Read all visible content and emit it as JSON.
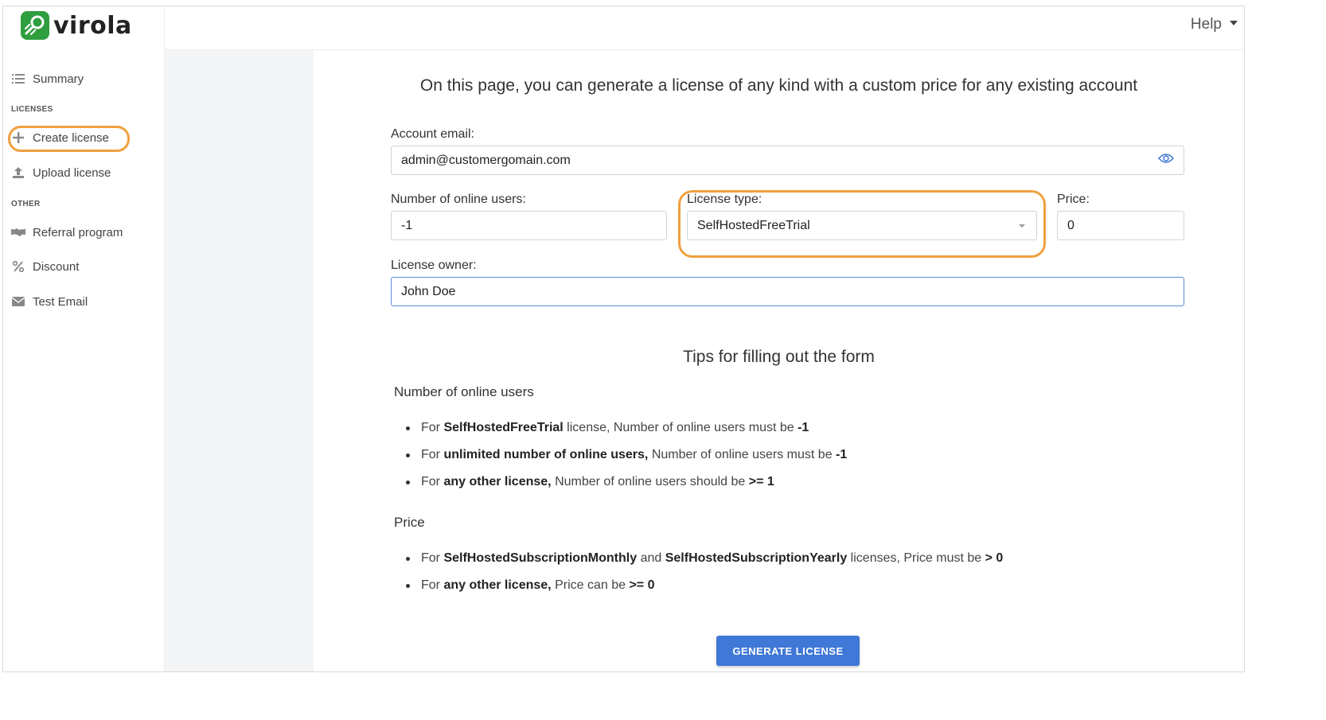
{
  "app": {
    "logo_text": "virola",
    "brand_color": "#2e9e3e",
    "highlight_color": "#f0a040",
    "accent_color": "#3f78d6"
  },
  "topbar": {
    "help_label": "Help"
  },
  "sidebar": {
    "summary_label": "Summary",
    "section_licenses": "LICENSES",
    "create_license_label": "Create license",
    "upload_license_label": "Upload license",
    "section_other": "OTHER",
    "referral_label": "Referral program",
    "discount_label": "Discount",
    "test_email_label": "Test Email"
  },
  "form": {
    "intro": "On this page, you can generate a license of any kind with a custom price for any existing account",
    "email_label": "Account email:",
    "email_value": "admin@customergomain.com",
    "users_label": "Number of online users:",
    "users_value": "-1",
    "license_type_label": "License type:",
    "license_type_value": "SelfHostedFreeTrial",
    "price_label": "Price:",
    "price_value": "0",
    "owner_label": "License owner:",
    "owner_value": "John Doe",
    "generate_button": "GENERATE LICENSE"
  },
  "tips": {
    "title": "Tips for filling out the form",
    "users_heading": "Number of online users",
    "users_tips": [
      {
        "pre": "For ",
        "bold": "SelfHostedFreeTrial",
        "mid": " license, Number of online users must be ",
        "bold2": "-1"
      },
      {
        "pre": "For ",
        "bold": "unlimited number of online users,",
        "mid": " Number of online users must be ",
        "bold2": "-1"
      },
      {
        "pre": "For ",
        "bold": "any other license,",
        "mid": " Number of online users should be ",
        "bold2": ">= 1"
      }
    ],
    "price_heading": "Price",
    "price_tips": [
      {
        "pre": "For ",
        "bold": "SelfHostedSubscriptionMonthly",
        "mid": " and ",
        "bold2": "SelfHostedSubscriptionYearly",
        "post": " licenses, Price must be ",
        "bold3": "> 0"
      },
      {
        "pre": "For ",
        "bold": "any other license,",
        "mid": " Price can be ",
        "bold2": ">= 0"
      }
    ]
  }
}
